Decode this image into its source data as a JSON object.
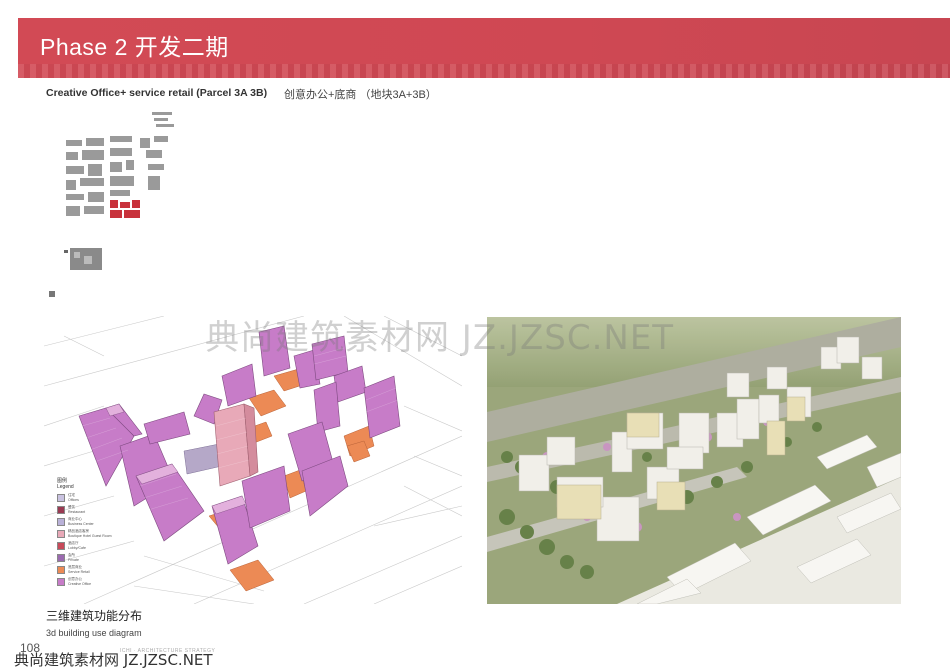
{
  "header": {
    "title": "Phase 2  开发二期",
    "subtitle_en": "Creative Office+ service retail (Parcel 3A 3B)",
    "subtitle_cn": "创意办公+底商  （地块3A+3B）"
  },
  "legend": {
    "title_cn": "图例",
    "title_en": "Legend",
    "items": [
      {
        "cn": "住宅",
        "en": "Offices",
        "color": "#c9c2e0"
      },
      {
        "cn": "餐饮",
        "en": "Restaurant",
        "color": "#9a3a52"
      },
      {
        "cn": "商业中心",
        "en": "Business Center",
        "color": "#b9b1d8"
      },
      {
        "cn": "精品酒店客房",
        "en": "Boutique Hotel Guest Room",
        "color": "#e8a9b8"
      },
      {
        "cn": "酒店厅",
        "en": "Lobby/Cafe",
        "color": "#c84a5a"
      },
      {
        "cn": "会所",
        "en": "Private",
        "color": "#9b6ab0"
      },
      {
        "cn": "底层商业",
        "en": "Service Retail",
        "color": "#ec8a55"
      },
      {
        "cn": "创意办公",
        "en": "Creative Office",
        "color": "#c77cc8"
      }
    ]
  },
  "captions": {
    "diagram_cn": "三维建筑功能分布",
    "diagram_en": "3d building use diagram"
  },
  "footer": {
    "page": "108",
    "tag": "ICHI · ARCHITECTURE STRATEGY"
  },
  "watermarks": {
    "center": "典尚建筑素材网 JZ.JZSC.NET",
    "bottom": "典尚建筑素材网 JZ.JZSC.NET"
  },
  "colors": {
    "banner": "#d24a55",
    "creative_office": "#c77cc8",
    "service_retail": "#ec8a55",
    "hotel": "#e8a9b8"
  }
}
